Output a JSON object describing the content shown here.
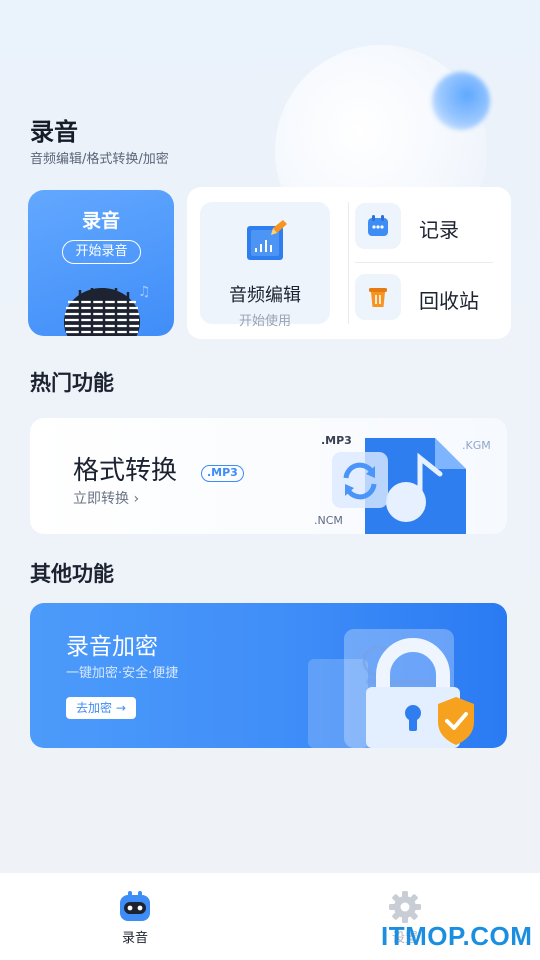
{
  "header": {
    "title": "录音",
    "subtitle": "音频编辑/格式转换/加密"
  },
  "record_card": {
    "title": "录音",
    "button_label": "开始录音",
    "icon": "microphone-icon"
  },
  "tools": {
    "audio_edit": {
      "label": "音频编辑",
      "sub": "开始使用",
      "icon": "audio-edit-icon"
    },
    "records": {
      "label": "记录",
      "icon": "calendar-icon"
    },
    "trash": {
      "label": "回收站",
      "icon": "trash-icon"
    }
  },
  "hot": {
    "section_title": "热门功能",
    "format": {
      "title": "格式转换",
      "badge": ".MP3",
      "link": "立即转换",
      "ext_mp3": ".MP3",
      "ext_kgm": ".KGM",
      "ext_ncm": ".NCM",
      "icon": "music-file-icon"
    }
  },
  "other": {
    "section_title": "其他功能",
    "encrypt": {
      "title": "录音加密",
      "subtitle": "一键加密·安全·便捷",
      "button_label": "去加密",
      "icon": "lock-icon"
    }
  },
  "tabbar": {
    "tabs": [
      {
        "label": "录音",
        "icon": "robot-icon",
        "active": true
      },
      {
        "label": "设置",
        "icon": "gear-icon",
        "active": false
      }
    ]
  },
  "watermark": "ITMOP.COM",
  "colors": {
    "accent": "#3e8cf6",
    "trash_orange": "#f7931e",
    "text_dark": "#1c2230",
    "text_muted": "#9aa3b2"
  }
}
